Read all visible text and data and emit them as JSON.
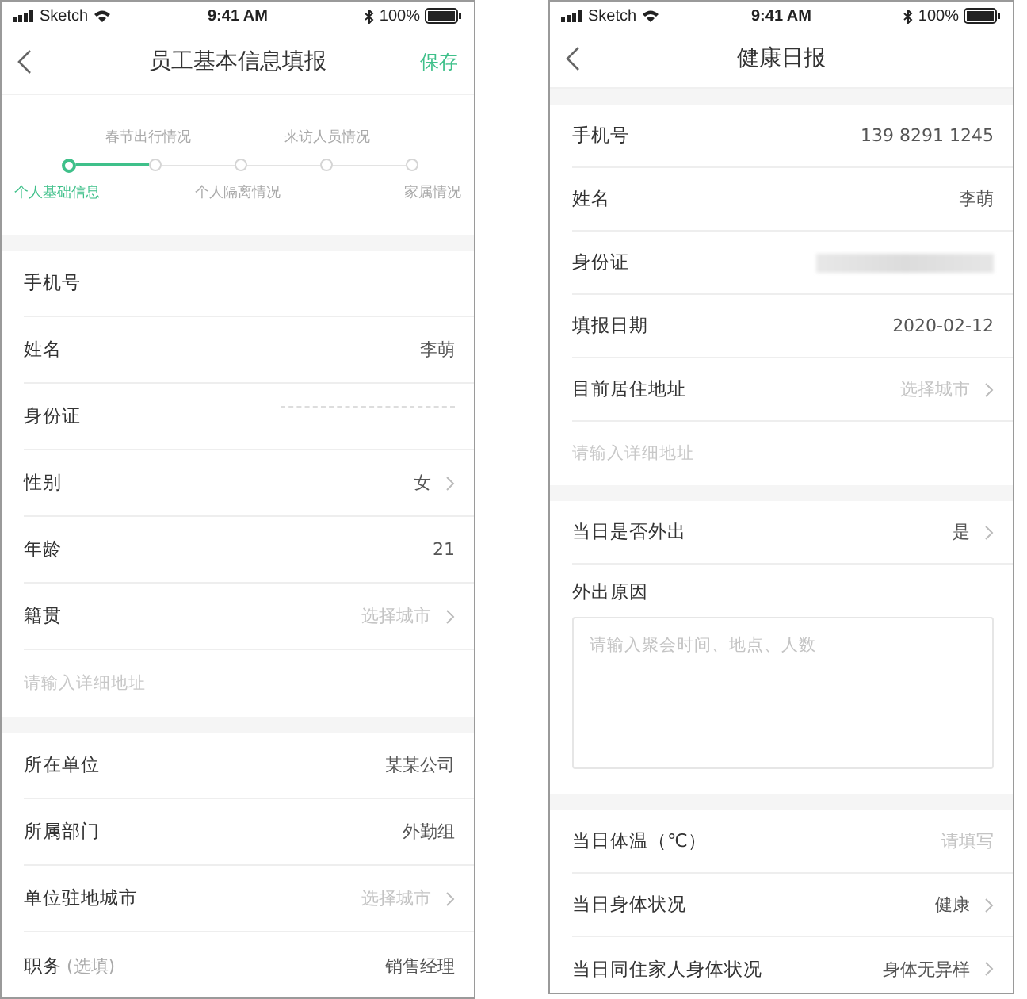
{
  "phones": [
    {
      "status_bar": {
        "carrier": "Sketch",
        "time": "9:41 AM",
        "battery": "100%"
      },
      "nav": {
        "title": "员工基本信息填报",
        "action": "保存"
      },
      "stepper": {
        "steps": [
          {
            "label": "个人基础信息",
            "selected": true
          },
          {
            "label": "春节出行情况",
            "selected": false
          },
          {
            "label": "个人隔离情况",
            "selected": false
          },
          {
            "label": "来访人员情况",
            "selected": false
          },
          {
            "label": "家属情况",
            "selected": false
          }
        ]
      },
      "sections": [
        {
          "rows": [
            {
              "kind": "field",
              "label": "手机号"
            },
            {
              "kind": "field",
              "label": "姓名",
              "value": "李萌"
            },
            {
              "kind": "masked",
              "label": "身份证"
            },
            {
              "kind": "field",
              "label": "性别",
              "value": "女",
              "chevron": true
            },
            {
              "kind": "field",
              "label": "年龄",
              "value": "21"
            },
            {
              "kind": "field",
              "label": "籍贯",
              "placeholder": "选择城市",
              "chevron": true
            },
            {
              "kind": "address",
              "placeholder": "请输入详细地址"
            }
          ]
        },
        {
          "rows": [
            {
              "kind": "field",
              "label": "所在单位",
              "value": "某某公司"
            },
            {
              "kind": "field",
              "label": "所属部门",
              "value": "外勤组"
            },
            {
              "kind": "field",
              "label": "单位驻地城市",
              "placeholder": "选择城市",
              "chevron": true
            },
            {
              "kind": "field",
              "label": "职务",
              "hint": "(选填)",
              "value": "销售经理"
            }
          ]
        }
      ]
    },
    {
      "status_bar": {
        "carrier": "Sketch",
        "time": "9:41 AM",
        "battery": "100%"
      },
      "nav": {
        "title": "健康日报"
      },
      "sections": [
        {
          "rows": [
            {
              "kind": "field",
              "label": "手机号",
              "value": "139 8291 1245"
            },
            {
              "kind": "field",
              "label": "姓名",
              "value": "李萌"
            },
            {
              "kind": "blurred",
              "label": "身份证"
            },
            {
              "kind": "field",
              "label": "填报日期",
              "value": "2020-02-12"
            },
            {
              "kind": "field",
              "label": "目前居住地址",
              "placeholder": "选择城市",
              "chevron": true
            },
            {
              "kind": "address",
              "placeholder": "请输入详细地址"
            }
          ]
        },
        {
          "rows": [
            {
              "kind": "field",
              "label": "当日是否外出",
              "value": "是",
              "chevron": true
            },
            {
              "kind": "textarea",
              "label": "外出原因",
              "placeholder": "请输入聚会时间、地点、人数"
            }
          ]
        },
        {
          "rows": [
            {
              "kind": "field",
              "label": "当日体温（℃）",
              "placeholder": "请填写"
            },
            {
              "kind": "field",
              "label": "当日身体状况",
              "value": "健康",
              "chevron": true
            },
            {
              "kind": "field",
              "label": "当日同住家人身体状况",
              "value": "身体无异样",
              "chevron": true
            }
          ]
        }
      ]
    }
  ]
}
